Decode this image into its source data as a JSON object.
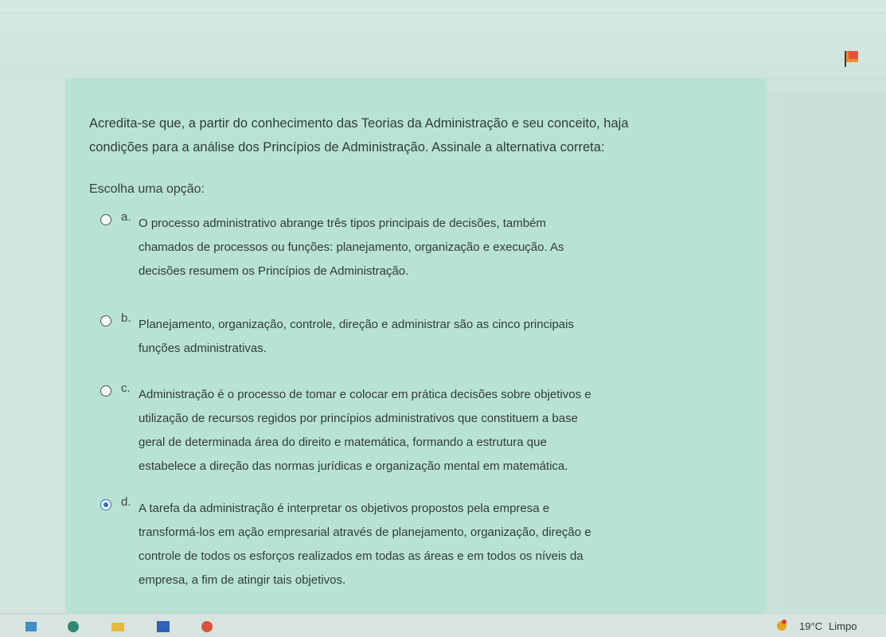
{
  "question": {
    "line1": "Acredita-se que, a partir do conhecimento das Teorias da Administração e seu conceito, haja",
    "line2": "condições para a análise dos Princípios de Administração. Assinale a alternativa correta:"
  },
  "prompt": "Escolha uma opção:",
  "options": [
    {
      "letter": "a.",
      "lines": [
        "O processo administrativo abrange três tipos principais de decisões, também",
        "chamados de processos ou funções: planejamento, organização e execução. As",
        "decisões resumem os Princípios de Administração."
      ],
      "selected": false
    },
    {
      "letter": "b.",
      "lines": [
        "Planejamento, organização, controle, direção e administrar são as cinco principais",
        "funções administrativas."
      ],
      "selected": false
    },
    {
      "letter": "c.",
      "lines": [
        "Administração é o processo de tomar e colocar em prática decisões sobre objetivos e",
        "utilização de recursos regidos por princípios administrativos que constituem a base",
        "geral de determinada área do direito e matemática, formando a estrutura que",
        "estabelece a direção das normas jurídicas e organização mental em matemática."
      ],
      "selected": false
    },
    {
      "letter": "d.",
      "lines": [
        "A tarefa da administração é interpretar os objetivos propostos pela empresa e",
        "transformá-los em ação empresarial através de planejamento, organização, direção e",
        "controle de todos os esforços realizados em todas as áreas e em todos os níveis da",
        "empresa, a fim de atingir tais objetivos."
      ],
      "selected": true
    }
  ],
  "taskbar": {
    "temperature": "19°C",
    "condition": "Limpo"
  },
  "colors": {
    "card": "#b9e2d6",
    "radio_selected": "#2f6ec8",
    "flag": "#e2543a"
  },
  "icons": [
    "flag-icon",
    "radio-icon",
    "taskbar-app-icon",
    "weather-icon"
  ]
}
